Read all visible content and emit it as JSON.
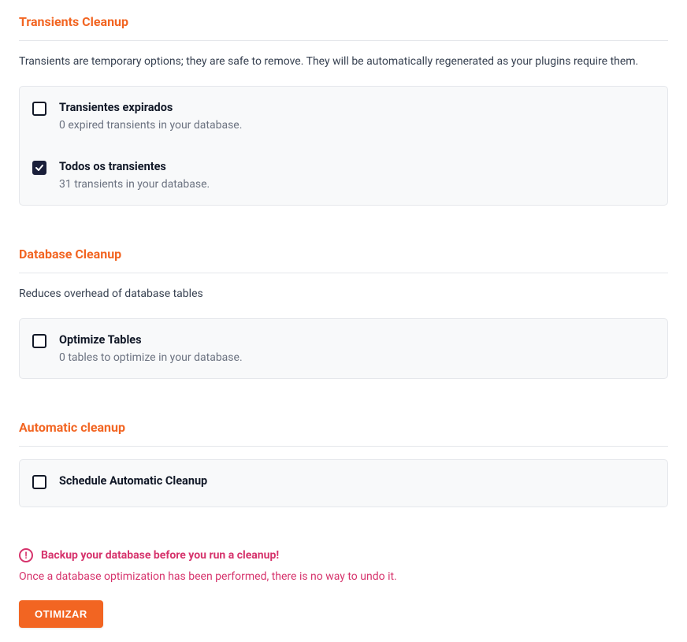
{
  "transients": {
    "title": "Transients Cleanup",
    "description": "Transients are temporary options; they are safe to remove. They will be automatically regenerated as your plugins require them.",
    "options": [
      {
        "label": "Transientes expirados",
        "sub": "0 expired transients in your database.",
        "checked": false
      },
      {
        "label": "Todos os transientes",
        "sub": "31 transients in your database.",
        "checked": true
      }
    ]
  },
  "database": {
    "title": "Database Cleanup",
    "description": "Reduces overhead of database tables",
    "options": [
      {
        "label": "Optimize Tables",
        "sub": "0 tables to optimize in your database.",
        "checked": false
      }
    ]
  },
  "automatic": {
    "title": "Automatic cleanup",
    "options": [
      {
        "label": "Schedule Automatic Cleanup",
        "checked": false
      }
    ]
  },
  "warning": {
    "bold": "Backup your database before you run a cleanup!",
    "sub": "Once a database optimization has been performed, there is no way to undo it."
  },
  "button": {
    "label": "OTIMIZAR"
  }
}
